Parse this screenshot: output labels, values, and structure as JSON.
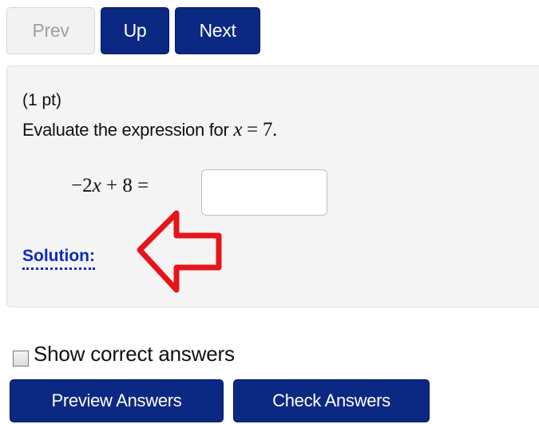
{
  "nav": {
    "prev_label": "Prev",
    "up_label": "Up",
    "next_label": "Next"
  },
  "problem": {
    "points": "(1 pt)",
    "prompt_text": "Evaluate the expression for ",
    "prompt_variable": "x",
    "prompt_equals": " = ",
    "prompt_value": "7",
    "prompt_period": ".",
    "expression_prefix": "−2",
    "expression_variable": "x",
    "expression_suffix": " + 8 =",
    "answer_value": "",
    "solution_label": "Solution:"
  },
  "controls": {
    "show_correct_label": "Show correct answers",
    "show_correct_checked": false,
    "preview_label": "Preview Answers",
    "check_label": "Check Answers"
  },
  "colors": {
    "button_primary": "#0b2882",
    "button_disabled": "#f2f2f2",
    "panel_background": "#f4f4f4",
    "link": "#0b2abf",
    "annotation_arrow": "#e8141b"
  },
  "annotation": {
    "icon": "red-outline-arrow-icon",
    "points_to": "Solution:"
  }
}
